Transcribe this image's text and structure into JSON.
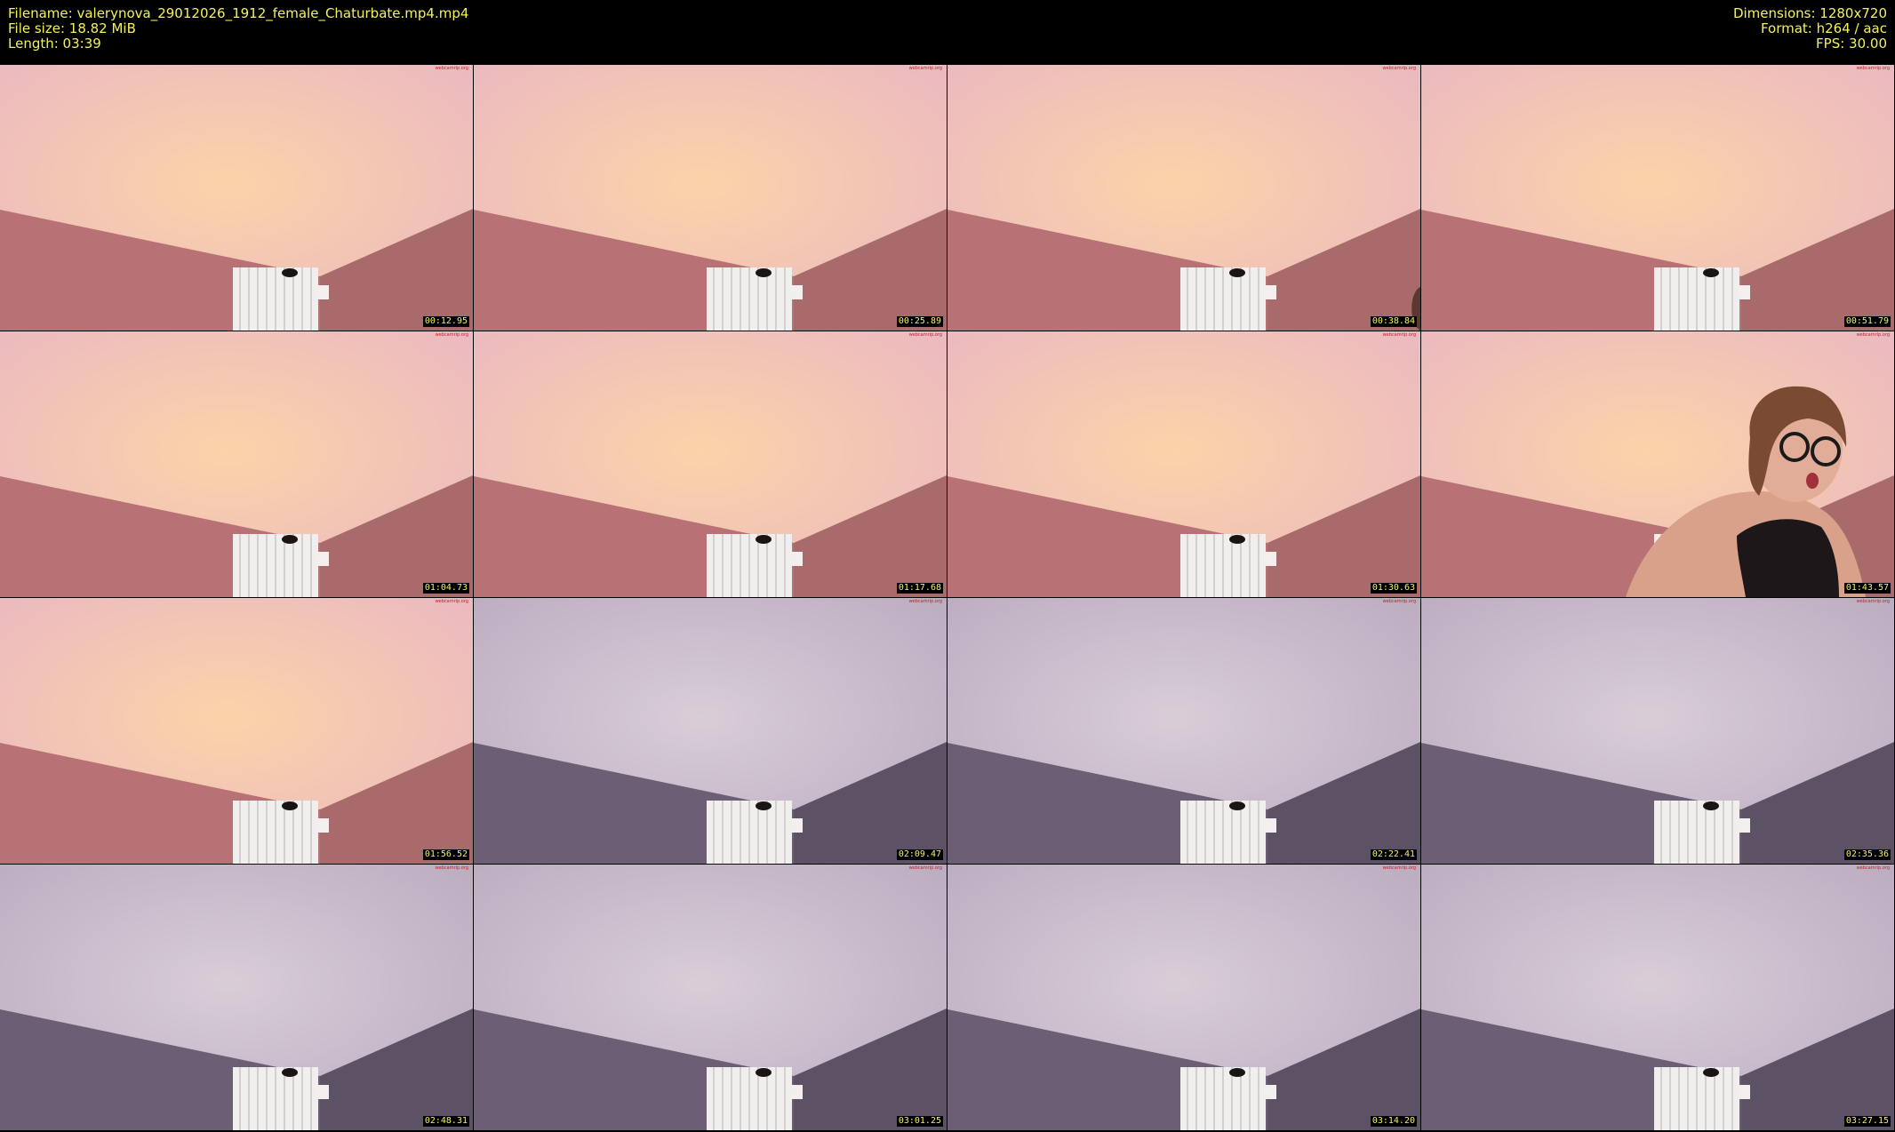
{
  "meta": {
    "filename": "Filename: valerynova_29012026_1912_female_Chaturbate.mp4.mp4",
    "filesize": "File size: 18.82 MiB",
    "length": "Length: 03:39",
    "dimensions": "Dimensions: 1280x720",
    "format": "Format: h264 / aac",
    "fps": "FPS: 30.00"
  },
  "thumbnails": [
    {
      "time": "00:12.95",
      "palette": "warm"
    },
    {
      "time": "00:25.89",
      "palette": "warm"
    },
    {
      "time": "00:38.84",
      "palette": "warm"
    },
    {
      "time": "00:51.79",
      "palette": "warm"
    },
    {
      "time": "01:04.73",
      "palette": "warm"
    },
    {
      "time": "01:17.68",
      "palette": "warm"
    },
    {
      "time": "01:30.63",
      "palette": "warm"
    },
    {
      "time": "01:43.57",
      "palette": "warm"
    },
    {
      "time": "01:56.52",
      "palette": "warm"
    },
    {
      "time": "02:09.47",
      "palette": "cool"
    },
    {
      "time": "02:22.41",
      "palette": "cool"
    },
    {
      "time": "02:35.36",
      "palette": "cool"
    },
    {
      "time": "02:48.31",
      "palette": "cool"
    },
    {
      "time": "03:01.25",
      "palette": "cool"
    },
    {
      "time": "03:14.20",
      "palette": "cool"
    },
    {
      "time": "03:27.15",
      "palette": "cool"
    }
  ],
  "watermark": "webcamrip.org",
  "colors": {
    "text": "#f2f25c",
    "warm_ceiling_light": "#fbd3a8",
    "warm_ceiling_edge": "#e9b6c3",
    "warm_wall_left": "#b87275",
    "warm_wall_right": "#a96a6b",
    "cool_ceiling_light": "#d9cdd8",
    "cool_ceiling_edge": "#b9a9be",
    "cool_wall_left": "#6c5f75",
    "cool_wall_right": "#5d5166"
  }
}
